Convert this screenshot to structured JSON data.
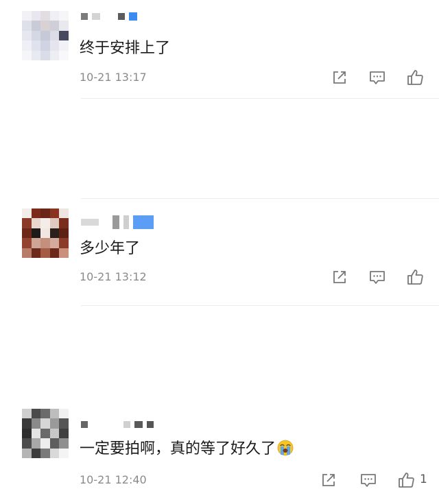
{
  "comments": [
    {
      "text": "终于安排上了",
      "time": "10-21 13:17",
      "like_count": ""
    },
    {
      "text": "多少年了",
      "time": "10-21 13:12",
      "like_count": ""
    },
    {
      "text": "一定要拍啊，真的等了好久了",
      "time": "10-21 12:40",
      "like_count": "1"
    }
  ],
  "icons": {
    "share": "share-icon",
    "reply": "comment-icon",
    "like": "thumbs-up-icon",
    "emoji": "loudly-crying-face-emoji"
  }
}
